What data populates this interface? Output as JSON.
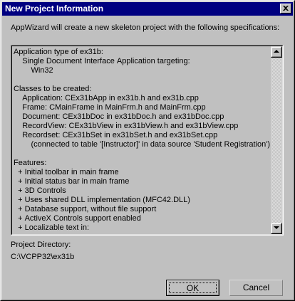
{
  "window": {
    "title": "New Project Information"
  },
  "intro": "AppWizard will create a new skeleton project with the following specifications:",
  "spec_lines": [
    "Application type of ex31b:",
    "    Single Document Interface Application targeting:",
    "        Win32",
    "",
    "Classes to be created:",
    "    Application: CEx31bApp in ex31b.h and ex31b.cpp",
    "    Frame: CMainFrame in MainFrm.h and MainFrm.cpp",
    "    Document: CEx31bDoc in ex31bDoc.h and ex31bDoc.cpp",
    "    RecordView: CEx31bView in ex31bView.h and ex31bView.cpp",
    "    Recordset: CEx31bSet in ex31bSet.h and ex31bSet.cpp",
    "        (connected to table '[Instructor]' in data source 'Student Registration')",
    "",
    "Features:",
    "  + Initial toolbar in main frame",
    "  + Initial status bar in main frame",
    "  + 3D Controls",
    "  + Uses shared DLL implementation (MFC42.DLL)",
    "  + Database support, without file support",
    "  + ActiveX Controls support enabled",
    "  + Localizable text in:"
  ],
  "project_dir_label": "Project Directory:",
  "project_dir_value": "C:\\VCPP32\\ex31b",
  "buttons": {
    "ok": "OK",
    "cancel": "Cancel"
  },
  "icons": {
    "close": "close-icon",
    "scroll_up": "arrow-up-icon",
    "scroll_down": "arrow-down-icon"
  },
  "colors": {
    "titlebar": "#000080",
    "face": "#c0c0c0"
  }
}
